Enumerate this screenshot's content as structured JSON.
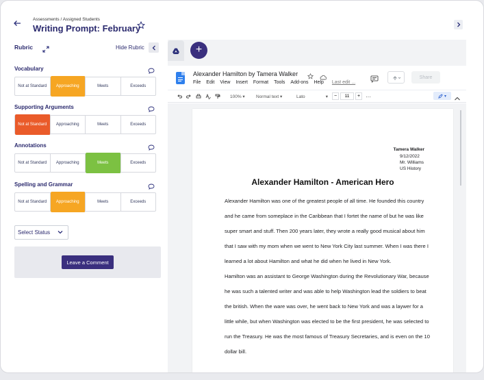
{
  "header": {
    "breadcrumb": "Assessments / Assigned Students",
    "title": "Writing Prompt: February"
  },
  "rubric": {
    "title": "Rubric",
    "hide_label": "Hide Rubric",
    "criteria": [
      {
        "label": "Vocabulary",
        "selected": "Approaching"
      },
      {
        "label": "Supporting Arguments",
        "selected": "Not at Standard"
      },
      {
        "label": "Annotations",
        "selected": "Meets"
      },
      {
        "label": "Spelling and Grammar",
        "selected": "Approaching"
      }
    ],
    "levels": [
      "Not at Standard",
      "Approaching",
      "Meets",
      "Exceeds"
    ],
    "status_placeholder": "Select Status",
    "leave_comment": "Leave a Comment"
  },
  "colors": {
    "brand": "#3a2f7e",
    "approaching": "#f6a623",
    "not_at_standard": "#ea5b2a",
    "meets": "#7cc142"
  },
  "doc": {
    "name": "Alexander Hamilton by Tamera Walker",
    "menu": [
      "File",
      "Edit",
      "View",
      "Insert",
      "Format",
      "Tools",
      "Add-ons",
      "Help"
    ],
    "last_edit": "Last edit ...",
    "share": "Share",
    "toolbar": {
      "zoom": "100%",
      "style": "Normal text",
      "font": "Lato",
      "font_size": "11",
      "more": "···"
    },
    "author": "Tamera Walker",
    "date": "9/12/2022",
    "teacher": "Mr. Williams",
    "course": "US History",
    "heading": "Alexander Hamilton - American Hero",
    "paragraph1": "Alexander Hamilton was one of the greatest people of all time. He founded this country and he came from someplace in the Caribbean that I fortet the name of but he was like super smart and stuff. Then 200 years later, they wrote a really good musical about him that I saw with my mom when we went to New York City last summer. When I was there I learned a lot about Hamilton and what he did when he lived in New York.",
    "paragraph2": "Hamilton was an assistant to George Washington during the Revolutionary War, because he was such a talented writer and was able to help Washington lead the soldiers to beat the british. When the ware was over, he went back to New York and was a laywer for a little while, but when Washington was elected to be the first president, he was selected to run the Treasury. He was the most famous of Treasury Secretaries, and is even on the 10 dollar bill."
  }
}
